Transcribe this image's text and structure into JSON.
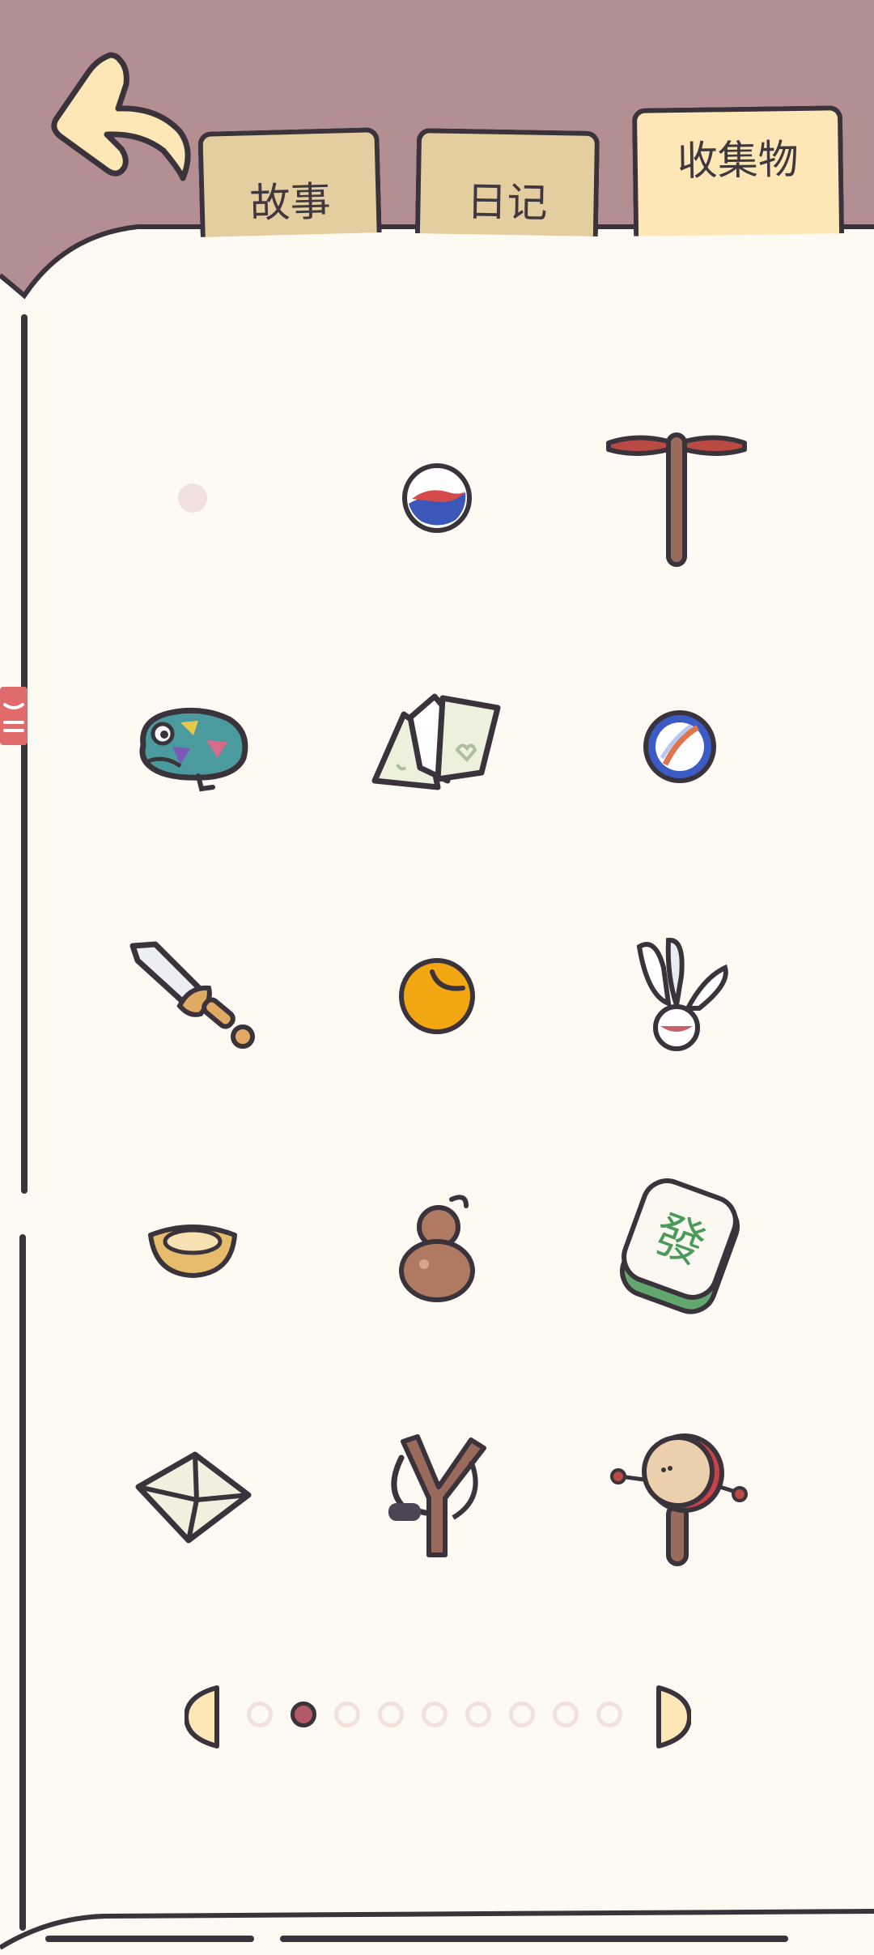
{
  "tabs": [
    {
      "label": "故事",
      "state": "inactive"
    },
    {
      "label": "日记",
      "state": "inactive"
    },
    {
      "label": "收集物",
      "state": "active"
    }
  ],
  "colors": {
    "background": "#b38f94",
    "paper": "#fdfaf4",
    "tab_inactive": "#e4cd9f",
    "tab_active": "#fde7b6",
    "outline": "#3b333b",
    "page_dot_current": "#b35a66"
  },
  "collection": {
    "items": [
      {
        "name": "locked-slot-dot"
      },
      {
        "name": "small-marble-icon"
      },
      {
        "name": "bamboo-dragonfly-icon"
      },
      {
        "name": "toy-frog-icon"
      },
      {
        "name": "paper-pieces-icon"
      },
      {
        "name": "blue-marble-icon"
      },
      {
        "name": "wooden-sword-icon"
      },
      {
        "name": "orange-bead-icon"
      },
      {
        "name": "shuttlecock-icon"
      },
      {
        "name": "gold-ingot-icon"
      },
      {
        "name": "gourd-icon"
      },
      {
        "name": "mahjong-tile-icon",
        "glyph": "發"
      },
      {
        "name": "paper-envelope-icon"
      },
      {
        "name": "slingshot-icon"
      },
      {
        "name": "rattle-drum-icon"
      }
    ]
  },
  "pagination": {
    "total_pages": 9,
    "current_page": 2
  }
}
